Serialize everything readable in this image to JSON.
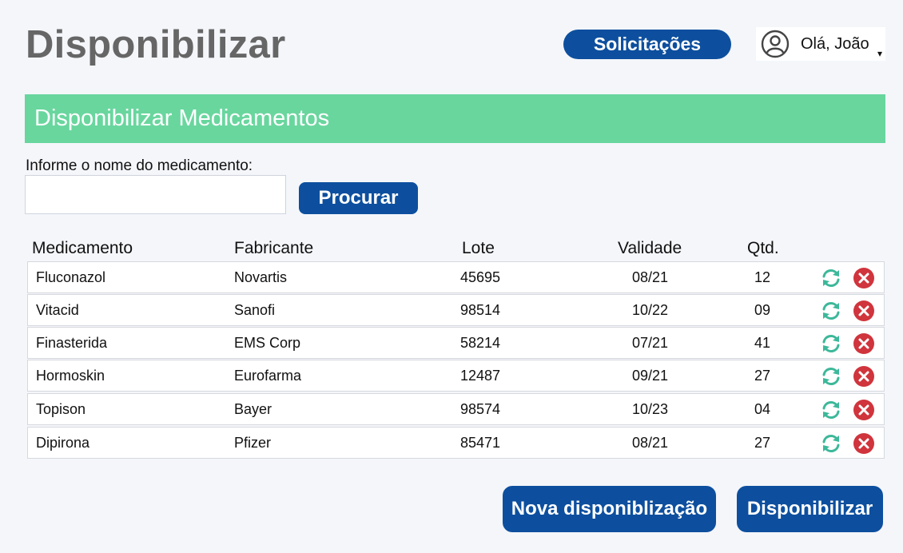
{
  "header": {
    "title": "Disponibilizar",
    "solicitacoes_label": "Solicitações",
    "user_greeting": "Olá, João",
    "caret": "▾"
  },
  "banner": {
    "title": "Disponibilizar Medicamentos"
  },
  "search": {
    "label": "Informe o nome do medicamento:",
    "value": "",
    "placeholder": "",
    "button_label": "Procurar"
  },
  "table": {
    "headers": [
      "Medicamento",
      "Fabricante",
      "Lote",
      "Validade",
      "Qtd."
    ],
    "rows": [
      [
        "Fluconazol",
        "Novartis",
        "45695",
        "08/21",
        "12"
      ],
      [
        "Vitacid",
        "Sanofi",
        "98514",
        "10/22",
        "09"
      ],
      [
        "Finasterida",
        "EMS Corp",
        "58214",
        "07/21",
        "41"
      ],
      [
        "Hormoskin",
        "Eurofarma",
        "12487",
        "09/21",
        "27"
      ],
      [
        "Topison",
        "Bayer",
        "98574",
        "10/23",
        "04"
      ],
      [
        "Dipirona",
        "Pfizer",
        "85471",
        "08/21",
        "27"
      ]
    ]
  },
  "footer": {
    "nova_label": "Nova disponiblização",
    "disponibilizar_label": "Disponibilizar"
  },
  "colors": {
    "primary": "#0d4f9e",
    "banner": "#69d69e",
    "refresh": "#3db89a",
    "delete": "#d0343c",
    "title": "#666666"
  },
  "icons": {
    "user": "user-circle-icon",
    "refresh": "refresh-icon",
    "delete": "delete-icon"
  }
}
